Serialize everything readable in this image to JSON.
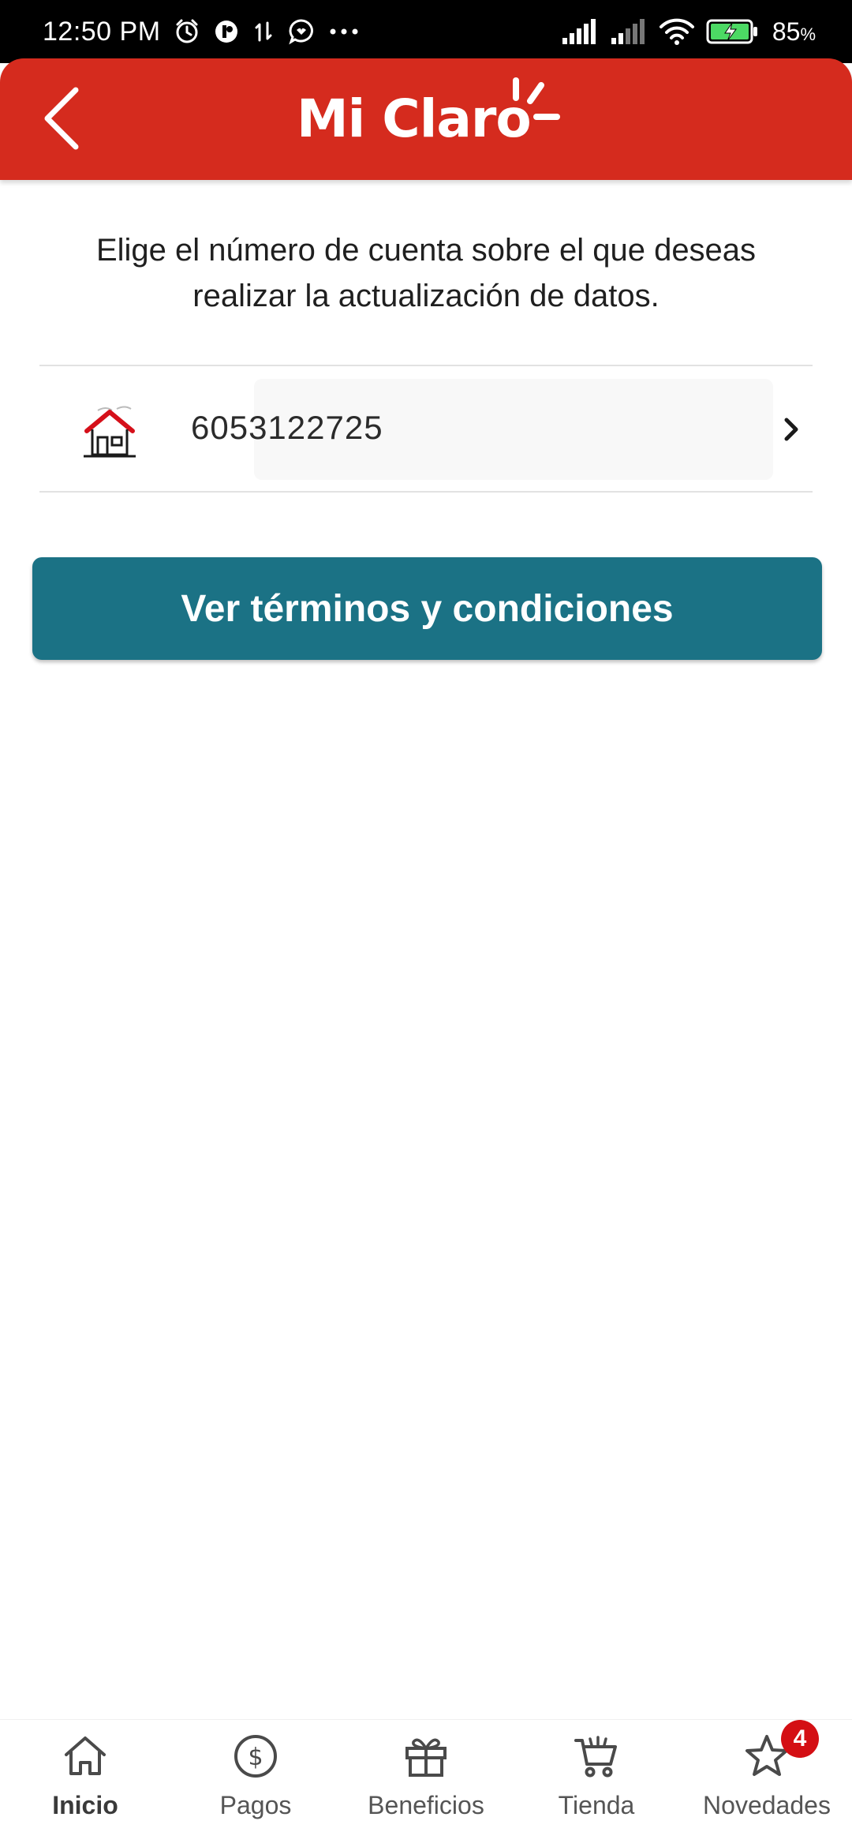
{
  "status_bar": {
    "time": "12:50 PM",
    "icons_left": [
      "alarm-icon",
      "app-notification-icon",
      "data-transfer-icon",
      "messenger-icon",
      "more-notifications-icon"
    ],
    "icons_right": [
      "signal-icon",
      "signal-secondary-icon",
      "wifi-icon",
      "battery-charging-icon"
    ],
    "battery_percent": "85",
    "battery_unit": "%"
  },
  "header": {
    "back_icon": "chevron-left-icon",
    "logo_text": "Mi Claro",
    "background_color": "#d52b1e"
  },
  "main": {
    "instructions": "Elige el número de cuenta sobre el que deseas realizar la actualización de datos.",
    "accounts": [
      {
        "icon": "house-icon",
        "number": "6053122725",
        "chevron": "chevron-right-icon"
      }
    ],
    "terms_button_label": "Ver términos y condiciones",
    "button_color": "#1b7285"
  },
  "bottom_nav": {
    "items": [
      {
        "label": "Inicio",
        "icon": "home-icon",
        "active": true
      },
      {
        "label": "Pagos",
        "icon": "dollar-circle-icon",
        "active": false
      },
      {
        "label": "Beneficios",
        "icon": "gift-icon",
        "active": false
      },
      {
        "label": "Tienda",
        "icon": "cart-icon",
        "active": false
      },
      {
        "label": "Novedades",
        "icon": "star-icon",
        "active": false,
        "badge": "4"
      }
    ]
  }
}
